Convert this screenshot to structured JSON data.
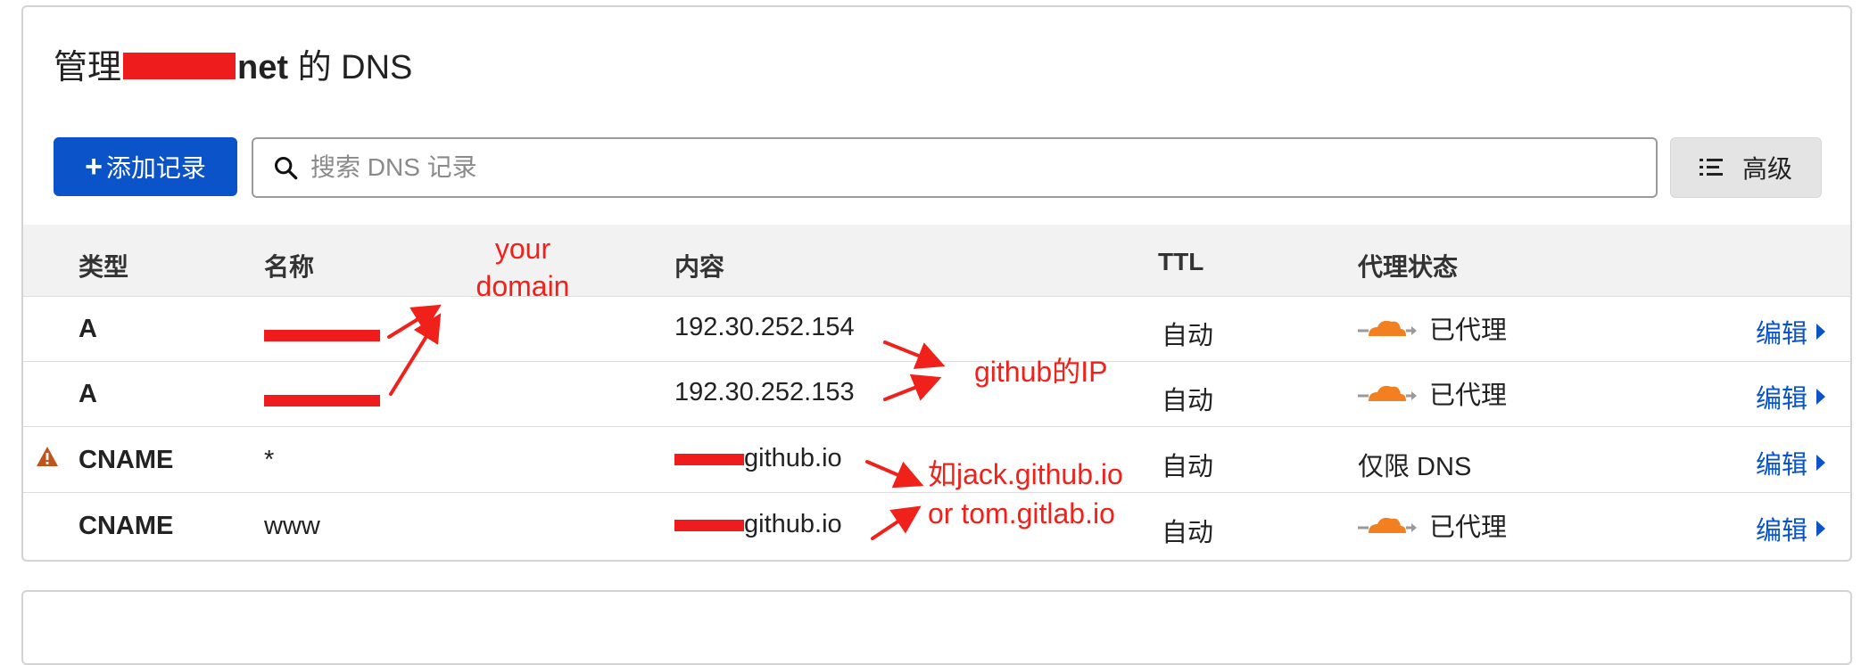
{
  "page": {
    "title_prefix": "管理",
    "title_domain_visible": "net",
    "title_suffix": "的 DNS"
  },
  "toolbar": {
    "add_label": "添加记录",
    "add_plus": "+",
    "search_placeholder": "搜索 DNS 记录",
    "advanced_label": "高级"
  },
  "table": {
    "headers": [
      "类型",
      "名称",
      "内容",
      "TTL",
      "代理状态"
    ],
    "rows": [
      {
        "type": "A",
        "name": "",
        "content": "192.30.252.154",
        "ttl": "自动",
        "proxy": "已代理",
        "proxied": true,
        "warning": false,
        "edit": "编辑"
      },
      {
        "type": "A",
        "name": "",
        "content": "192.30.252.153",
        "ttl": "自动",
        "proxy": "已代理",
        "proxied": true,
        "warning": false,
        "edit": "编辑"
      },
      {
        "type": "CNAME",
        "name": "*",
        "content_suffix": "github.io",
        "ttl": "自动",
        "proxy": "仅限 DNS",
        "proxied": false,
        "warning": true,
        "edit": "编辑"
      },
      {
        "type": "CNAME",
        "name": "www",
        "content_suffix": "github.io",
        "ttl": "自动",
        "proxy": "已代理",
        "proxied": true,
        "warning": false,
        "edit": "编辑"
      }
    ]
  },
  "annotations": {
    "your_domain_line1": "your",
    "your_domain_line2": "domain",
    "github_ip": "github的IP",
    "example_line1": "如jack.github.io",
    "example_line2": "or tom.gitlab.io"
  },
  "colors": {
    "primary": "#0b53c8",
    "annotation": "#f0201a",
    "cloud": "#f38020",
    "warning": "#c0541a"
  }
}
